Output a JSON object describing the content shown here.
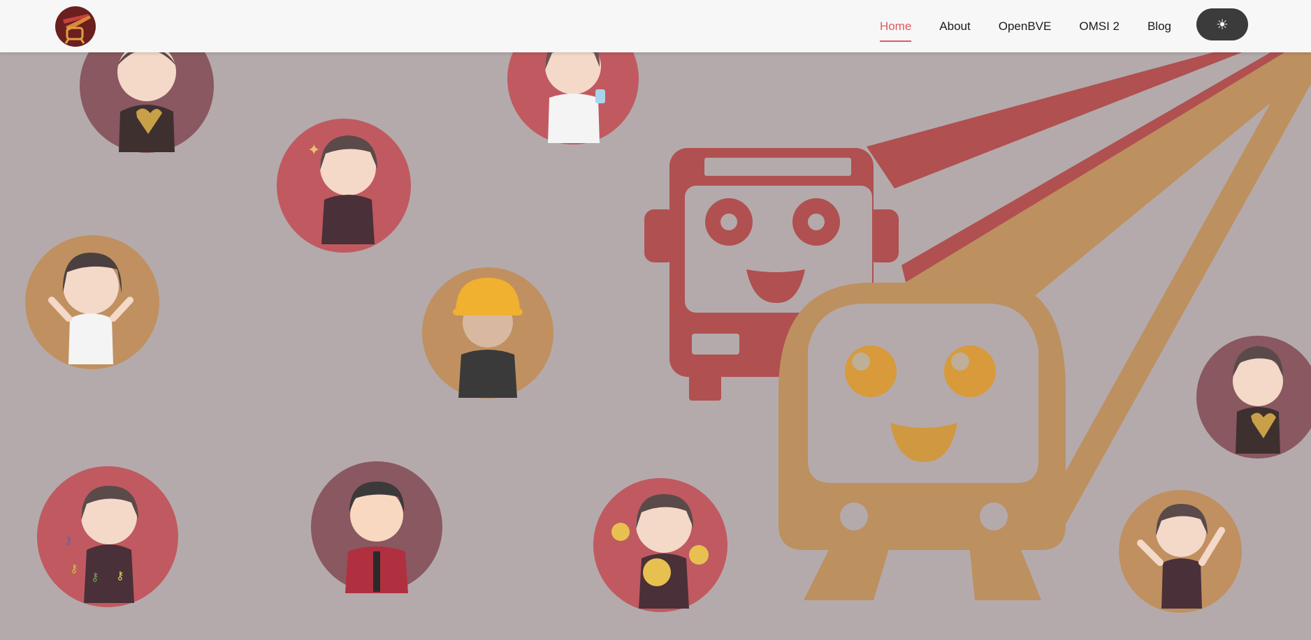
{
  "navbar": {
    "links": [
      {
        "label": "Home",
        "active": true
      },
      {
        "label": "About",
        "active": false
      },
      {
        "label": "OpenBVE",
        "active": false
      },
      {
        "label": "OMSI 2",
        "active": false
      },
      {
        "label": "Blog",
        "active": false
      }
    ],
    "theme_toggle_icon": "☀",
    "theme_toggle_icon_name": "sun-icon"
  },
  "colors": {
    "background": "#b4aaab",
    "navbar_bg": "#f7f7f7",
    "accent_red": "#e05a5a",
    "bus_red": "#b05050",
    "train_tan": "#bd9060",
    "circle_red": "#c05a60",
    "circle_maroon": "#8a5860",
    "circle_tan": "#c09060",
    "toggle_bg": "#3b3b3b"
  },
  "hero": {
    "mascots": [
      {
        "name": "bus-mascot",
        "description": "red bus with smiling face"
      },
      {
        "name": "train-mascot",
        "description": "tan train with smiling face"
      }
    ],
    "avatars": [
      {
        "name": "avatar-boy-heart",
        "circle": "maroon"
      },
      {
        "name": "avatar-girl-water",
        "circle": "red"
      },
      {
        "name": "avatar-girl-ok-sign",
        "circle": "red"
      },
      {
        "name": "avatar-girl-cheering",
        "circle": "tan"
      },
      {
        "name": "avatar-worker-helmet",
        "circle": "tan"
      },
      {
        "name": "avatar-boy-heart-right",
        "circle": "maroon"
      },
      {
        "name": "avatar-girl-keys",
        "circle": "red"
      },
      {
        "name": "avatar-man-suit",
        "circle": "maroon"
      },
      {
        "name": "avatar-girl-emoji",
        "circle": "red"
      },
      {
        "name": "avatar-girl-waving",
        "circle": "tan"
      }
    ]
  }
}
